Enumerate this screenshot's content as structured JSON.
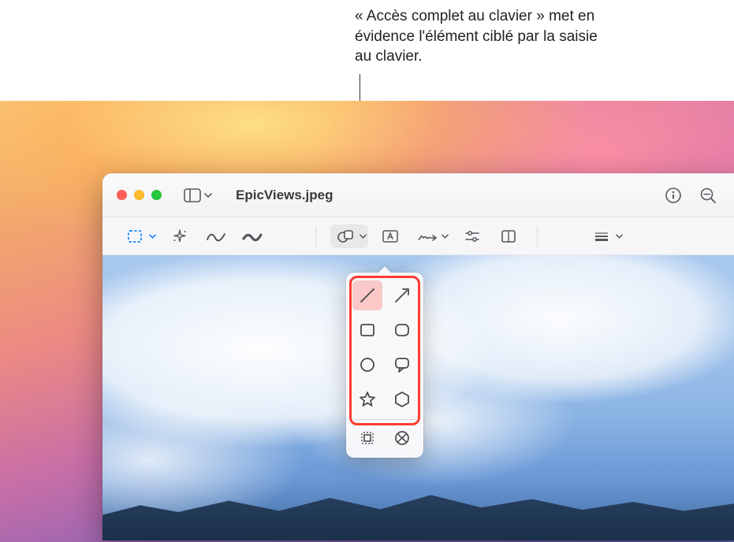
{
  "callout": {
    "text": "« Accès complet au clavier » met en évidence l'élément ciblé par la saisie au clavier."
  },
  "window": {
    "title": "EpicViews.jpeg"
  },
  "icons": {
    "sidebar": "sidebar",
    "info": "info",
    "zoom_out": "zoom-out"
  },
  "toolbar": {
    "selection": "selection-rect",
    "instant_alpha": "instant-alpha",
    "sketch": "sketch",
    "draw": "draw",
    "shapes": "shapes",
    "text": "text",
    "sign": "sign",
    "adjust": "adjust-color",
    "crop": "crop",
    "alignment": "alignment"
  },
  "shapes_popover": {
    "items": [
      "line",
      "arrow",
      "rect-outline",
      "rect-filled",
      "circle",
      "speech-bubble",
      "star",
      "hexagon"
    ],
    "footer": [
      "loupe",
      "mask"
    ]
  }
}
